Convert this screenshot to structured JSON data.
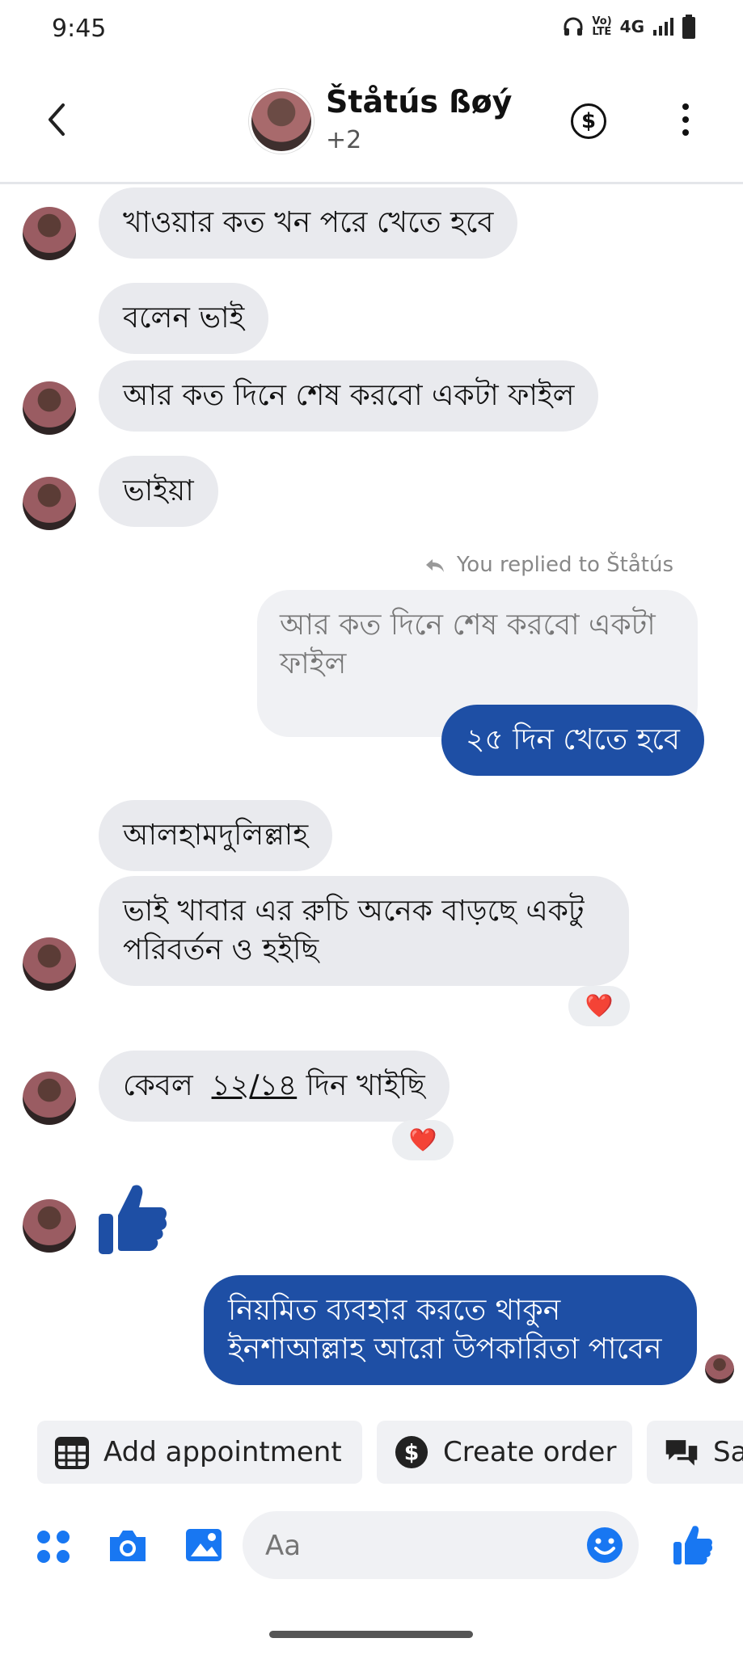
{
  "status_bar": {
    "time": "9:45",
    "network": "4G"
  },
  "header": {
    "name": "Štåtús ßøý",
    "subtitle": "+2",
    "icons": [
      "back-icon",
      "dollar-icon",
      "more-icon"
    ]
  },
  "messages": {
    "m1": "খাওয়ার কত খন পরে খেতে হবে",
    "m2": "বলেন ভাই",
    "m3": "আর কত দিনে শেষ করবো একটা ফাইল",
    "m4": "ভাইয়া",
    "reply_note": "You replied to Štåtús",
    "quoted_line1": "আর কত দিনে শেষ করবো একটা",
    "quoted_line2": "ফাইল",
    "m5": "২৫ দিন খেতে হবে",
    "m6": "আলহামদুলিল্লাহ",
    "m7_line1": "ভাই খাবার এর রুচি অনেক বাড়ছে একটু",
    "m7_line2": "পরিবর্তন ও হইছি",
    "m8_prefix": "কেবল",
    "m8_underlined": "১২/১৪",
    "m8_suffix": "দিন খাইছি",
    "m9_line1": "নিয়মিত ব্যবহার করতে থাকুন",
    "m9_line2": "ইনশাআল্লাহ আরো উপকারিতা পাবেন",
    "reaction": "❤️"
  },
  "quick_actions": {
    "add_appointment": "Add appointment",
    "create_order": "Create order",
    "save_partial": "Sa"
  },
  "composer": {
    "placeholder": "Aa"
  },
  "colors": {
    "outgoing": "#1e4fa5",
    "incoming": "#e9eaee",
    "accent": "#1877f2"
  }
}
